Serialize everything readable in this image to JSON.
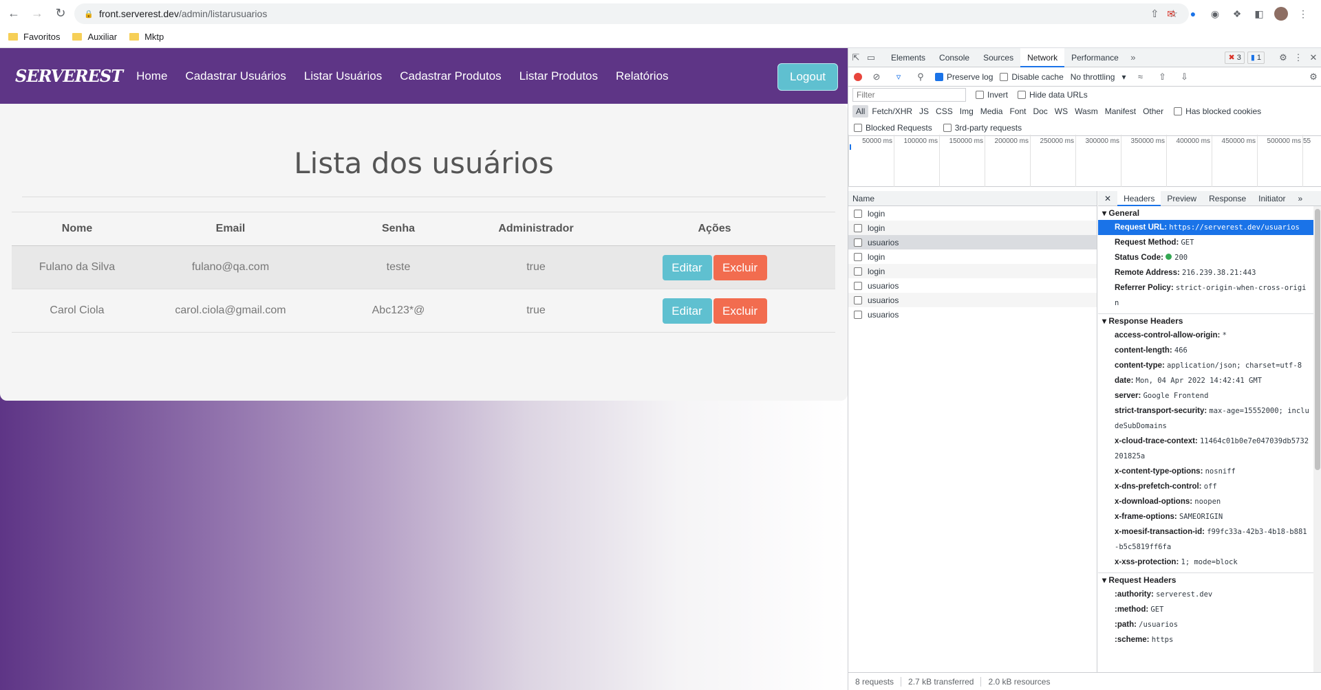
{
  "browser": {
    "url_domain": "front.serverest.dev",
    "url_path": "/admin/listarusuarios",
    "bookmarks": [
      "Favoritos",
      "Auxiliar",
      "Mktp"
    ]
  },
  "app": {
    "logo": "SERVEREST",
    "nav": [
      "Home",
      "Cadastrar Usuários",
      "Listar Usuários",
      "Cadastrar Produtos",
      "Listar Produtos",
      "Relatórios"
    ],
    "logout": "Logout",
    "title": "Lista dos usuários",
    "table": {
      "headers": [
        "Nome",
        "Email",
        "Senha",
        "Administrador",
        "Ações"
      ],
      "rows": [
        {
          "nome": "Fulano da Silva",
          "email": "fulano@qa.com",
          "senha": "teste",
          "admin": "true"
        },
        {
          "nome": "Carol Ciola",
          "email": "carol.ciola@gmail.com",
          "senha": "Abc123*@",
          "admin": "true"
        }
      ],
      "edit_label": "Editar",
      "delete_label": "Excluir"
    }
  },
  "devtools": {
    "tabs": [
      "Elements",
      "Console",
      "Sources",
      "Network",
      "Performance"
    ],
    "errors": "3",
    "messages": "1",
    "toolbar": {
      "preserve_log": "Preserve log",
      "disable_cache": "Disable cache",
      "throttling": "No throttling"
    },
    "filter_placeholder": "Filter",
    "invert": "Invert",
    "hide_data_urls": "Hide data URLs",
    "types": [
      "All",
      "Fetch/XHR",
      "JS",
      "CSS",
      "Img",
      "Media",
      "Font",
      "Doc",
      "WS",
      "Wasm",
      "Manifest",
      "Other"
    ],
    "has_blocked_cookies": "Has blocked cookies",
    "blocked_requests": "Blocked Requests",
    "third_party": "3rd-party requests",
    "timeline_ticks": [
      "50000 ms",
      "100000 ms",
      "150000 ms",
      "200000 ms",
      "250000 ms",
      "300000 ms",
      "350000 ms",
      "400000 ms",
      "450000 ms",
      "500000 ms",
      "55"
    ],
    "name_header": "Name",
    "requests": [
      "login",
      "login",
      "usuarios",
      "login",
      "login",
      "usuarios",
      "usuarios",
      "usuarios"
    ],
    "detail_tabs": [
      "Headers",
      "Preview",
      "Response",
      "Initiator"
    ],
    "general_title": "General",
    "general": [
      {
        "k": "Request URL:",
        "v": "https://serverest.dev/usuarios"
      },
      {
        "k": "Request Method:",
        "v": "GET"
      },
      {
        "k": "Status Code:",
        "v": "200"
      },
      {
        "k": "Remote Address:",
        "v": "216.239.38.21:443"
      },
      {
        "k": "Referrer Policy:",
        "v": "strict-origin-when-cross-origin"
      }
    ],
    "response_title": "Response Headers",
    "response": [
      {
        "k": "access-control-allow-origin:",
        "v": "*"
      },
      {
        "k": "content-length:",
        "v": "466"
      },
      {
        "k": "content-type:",
        "v": "application/json; charset=utf-8"
      },
      {
        "k": "date:",
        "v": "Mon, 04 Apr 2022 14:42:41 GMT"
      },
      {
        "k": "server:",
        "v": "Google Frontend"
      },
      {
        "k": "strict-transport-security:",
        "v": "max-age=15552000; includeSubDomains"
      },
      {
        "k": "x-cloud-trace-context:",
        "v": "11464c01b0e7e047039db5732201825a"
      },
      {
        "k": "x-content-type-options:",
        "v": "nosniff"
      },
      {
        "k": "x-dns-prefetch-control:",
        "v": "off"
      },
      {
        "k": "x-download-options:",
        "v": "noopen"
      },
      {
        "k": "x-frame-options:",
        "v": "SAMEORIGIN"
      },
      {
        "k": "x-moesif-transaction-id:",
        "v": "f99fc33a-42b3-4b18-b881-b5c5819ff6fa"
      },
      {
        "k": "x-xss-protection:",
        "v": "1; mode=block"
      }
    ],
    "request_title": "Request Headers",
    "request": [
      {
        "k": ":authority:",
        "v": "serverest.dev"
      },
      {
        "k": ":method:",
        "v": "GET"
      },
      {
        "k": ":path:",
        "v": "/usuarios"
      },
      {
        "k": ":scheme:",
        "v": "https"
      }
    ],
    "footer": [
      "8 requests",
      "2.7 kB transferred",
      "2.0 kB resources"
    ]
  }
}
